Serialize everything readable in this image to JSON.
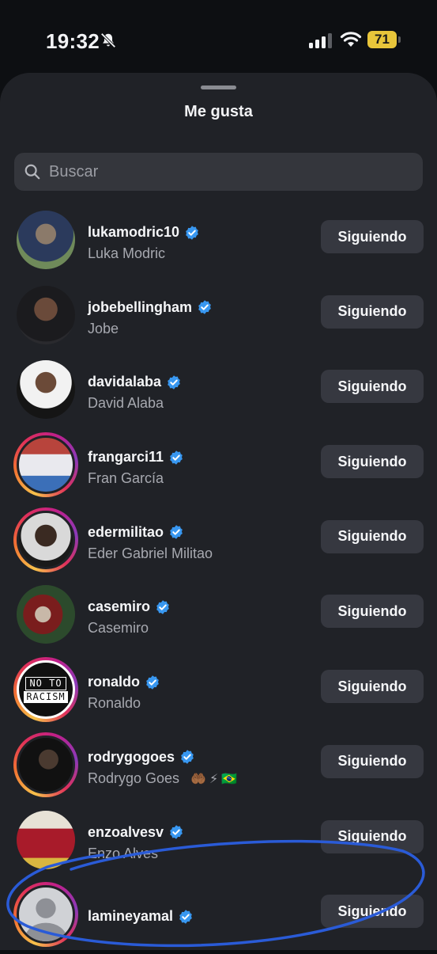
{
  "status_bar": {
    "time": "19:32",
    "battery": "71",
    "icons": [
      "bell-slash-icon",
      "signal-icon",
      "wifi-icon",
      "battery-icon"
    ]
  },
  "sheet": {
    "title": "Me gusta",
    "search_placeholder": "Buscar"
  },
  "colors": {
    "background": "#0d0f12",
    "sheet": "#202227",
    "search_bg": "#34363c",
    "button_bg": "#363840",
    "verified": "#3897f0",
    "battery": "#e8c53a",
    "annotation": "#2a5bd7"
  },
  "users": [
    {
      "username": "lukamodric10",
      "full_name": "Luka Modric",
      "verified": true,
      "button": "Siguiendo",
      "story_ring": false,
      "emojis": ""
    },
    {
      "username": "jobebellingham",
      "full_name": "Jobe",
      "verified": true,
      "button": "Siguiendo",
      "story_ring": false,
      "emojis": ""
    },
    {
      "username": "davidalaba",
      "full_name": "David Alaba",
      "verified": true,
      "button": "Siguiendo",
      "story_ring": false,
      "emojis": ""
    },
    {
      "username": "frangarci11",
      "full_name": "Fran García",
      "verified": true,
      "button": "Siguiendo",
      "story_ring": true,
      "emojis": ""
    },
    {
      "username": "edermilitao",
      "full_name": "Eder Gabriel Militao",
      "verified": true,
      "button": "Siguiendo",
      "story_ring": true,
      "emojis": ""
    },
    {
      "username": "casemiro",
      "full_name": "Casemiro",
      "verified": true,
      "button": "Siguiendo",
      "story_ring": false,
      "emojis": ""
    },
    {
      "username": "ronaldo",
      "full_name": "Ronaldo",
      "verified": true,
      "button": "Siguiendo",
      "story_ring": true,
      "emojis": "",
      "avatar_text": [
        "NO TO",
        "RACISM"
      ]
    },
    {
      "username": "rodrygogoes",
      "full_name": "Rodrygo Goes",
      "verified": true,
      "button": "Siguiendo",
      "story_ring": true,
      "emojis": "🤲🏾⚡🇧🇷"
    },
    {
      "username": "enzoalvesv",
      "full_name": "Enzo Alves",
      "verified": true,
      "button": "Siguiendo",
      "story_ring": false,
      "emojis": ""
    },
    {
      "username": "lamineyamal",
      "full_name": "",
      "verified": true,
      "button": "Siguiendo",
      "story_ring": true,
      "emojis": ""
    }
  ]
}
